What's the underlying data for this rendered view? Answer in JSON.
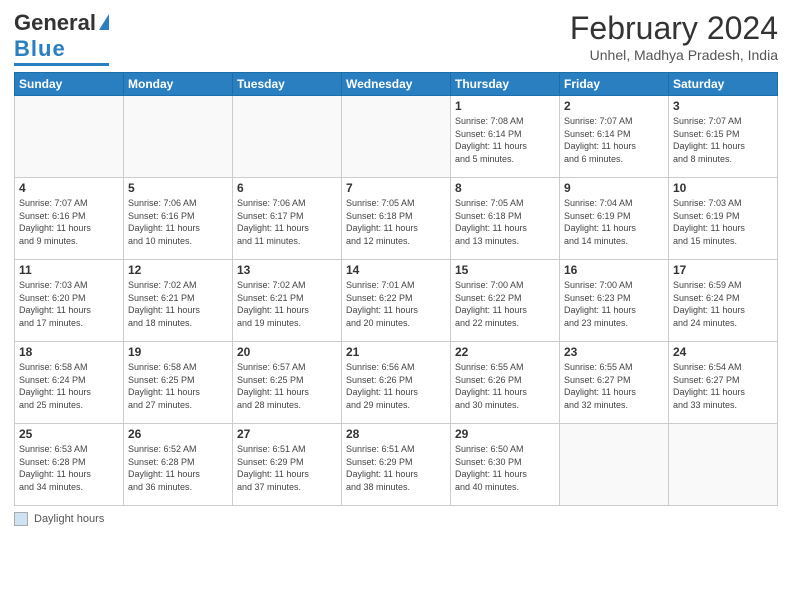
{
  "logo": {
    "line1": "General",
    "line2": "Blue"
  },
  "title": "February 2024",
  "subtitle": "Unhel, Madhya Pradesh, India",
  "days_of_week": [
    "Sunday",
    "Monday",
    "Tuesday",
    "Wednesday",
    "Thursday",
    "Friday",
    "Saturday"
  ],
  "footer": {
    "icon_label": "daylight-box",
    "text": "Daylight hours"
  },
  "weeks": [
    [
      {
        "day": "",
        "info": ""
      },
      {
        "day": "",
        "info": ""
      },
      {
        "day": "",
        "info": ""
      },
      {
        "day": "",
        "info": ""
      },
      {
        "day": "1",
        "info": "Sunrise: 7:08 AM\nSunset: 6:14 PM\nDaylight: 11 hours\nand 5 minutes."
      },
      {
        "day": "2",
        "info": "Sunrise: 7:07 AM\nSunset: 6:14 PM\nDaylight: 11 hours\nand 6 minutes."
      },
      {
        "day": "3",
        "info": "Sunrise: 7:07 AM\nSunset: 6:15 PM\nDaylight: 11 hours\nand 8 minutes."
      }
    ],
    [
      {
        "day": "4",
        "info": "Sunrise: 7:07 AM\nSunset: 6:16 PM\nDaylight: 11 hours\nand 9 minutes."
      },
      {
        "day": "5",
        "info": "Sunrise: 7:06 AM\nSunset: 6:16 PM\nDaylight: 11 hours\nand 10 minutes."
      },
      {
        "day": "6",
        "info": "Sunrise: 7:06 AM\nSunset: 6:17 PM\nDaylight: 11 hours\nand 11 minutes."
      },
      {
        "day": "7",
        "info": "Sunrise: 7:05 AM\nSunset: 6:18 PM\nDaylight: 11 hours\nand 12 minutes."
      },
      {
        "day": "8",
        "info": "Sunrise: 7:05 AM\nSunset: 6:18 PM\nDaylight: 11 hours\nand 13 minutes."
      },
      {
        "day": "9",
        "info": "Sunrise: 7:04 AM\nSunset: 6:19 PM\nDaylight: 11 hours\nand 14 minutes."
      },
      {
        "day": "10",
        "info": "Sunrise: 7:03 AM\nSunset: 6:19 PM\nDaylight: 11 hours\nand 15 minutes."
      }
    ],
    [
      {
        "day": "11",
        "info": "Sunrise: 7:03 AM\nSunset: 6:20 PM\nDaylight: 11 hours\nand 17 minutes."
      },
      {
        "day": "12",
        "info": "Sunrise: 7:02 AM\nSunset: 6:21 PM\nDaylight: 11 hours\nand 18 minutes."
      },
      {
        "day": "13",
        "info": "Sunrise: 7:02 AM\nSunset: 6:21 PM\nDaylight: 11 hours\nand 19 minutes."
      },
      {
        "day": "14",
        "info": "Sunrise: 7:01 AM\nSunset: 6:22 PM\nDaylight: 11 hours\nand 20 minutes."
      },
      {
        "day": "15",
        "info": "Sunrise: 7:00 AM\nSunset: 6:22 PM\nDaylight: 11 hours\nand 22 minutes."
      },
      {
        "day": "16",
        "info": "Sunrise: 7:00 AM\nSunset: 6:23 PM\nDaylight: 11 hours\nand 23 minutes."
      },
      {
        "day": "17",
        "info": "Sunrise: 6:59 AM\nSunset: 6:24 PM\nDaylight: 11 hours\nand 24 minutes."
      }
    ],
    [
      {
        "day": "18",
        "info": "Sunrise: 6:58 AM\nSunset: 6:24 PM\nDaylight: 11 hours\nand 25 minutes."
      },
      {
        "day": "19",
        "info": "Sunrise: 6:58 AM\nSunset: 6:25 PM\nDaylight: 11 hours\nand 27 minutes."
      },
      {
        "day": "20",
        "info": "Sunrise: 6:57 AM\nSunset: 6:25 PM\nDaylight: 11 hours\nand 28 minutes."
      },
      {
        "day": "21",
        "info": "Sunrise: 6:56 AM\nSunset: 6:26 PM\nDaylight: 11 hours\nand 29 minutes."
      },
      {
        "day": "22",
        "info": "Sunrise: 6:55 AM\nSunset: 6:26 PM\nDaylight: 11 hours\nand 30 minutes."
      },
      {
        "day": "23",
        "info": "Sunrise: 6:55 AM\nSunset: 6:27 PM\nDaylight: 11 hours\nand 32 minutes."
      },
      {
        "day": "24",
        "info": "Sunrise: 6:54 AM\nSunset: 6:27 PM\nDaylight: 11 hours\nand 33 minutes."
      }
    ],
    [
      {
        "day": "25",
        "info": "Sunrise: 6:53 AM\nSunset: 6:28 PM\nDaylight: 11 hours\nand 34 minutes."
      },
      {
        "day": "26",
        "info": "Sunrise: 6:52 AM\nSunset: 6:28 PM\nDaylight: 11 hours\nand 36 minutes."
      },
      {
        "day": "27",
        "info": "Sunrise: 6:51 AM\nSunset: 6:29 PM\nDaylight: 11 hours\nand 37 minutes."
      },
      {
        "day": "28",
        "info": "Sunrise: 6:51 AM\nSunset: 6:29 PM\nDaylight: 11 hours\nand 38 minutes."
      },
      {
        "day": "29",
        "info": "Sunrise: 6:50 AM\nSunset: 6:30 PM\nDaylight: 11 hours\nand 40 minutes."
      },
      {
        "day": "",
        "info": ""
      },
      {
        "day": "",
        "info": ""
      }
    ]
  ]
}
